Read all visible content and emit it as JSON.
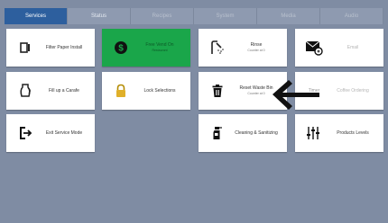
{
  "tabs": [
    "Services",
    "Status",
    "Recipes",
    "System",
    "Media",
    "Audio"
  ],
  "tiles": {
    "filter_paper": {
      "label": "Filter Paper Install"
    },
    "free_vend": {
      "label": "Free Vend On",
      "sub": "Restaurant"
    },
    "rinse": {
      "label": "Rinse",
      "sub": "Counter at 0"
    },
    "email": {
      "label": "Email"
    },
    "fill_carafe": {
      "label": "Fill up a Carafe"
    },
    "lock": {
      "label": "Lock Selections"
    },
    "reset_waste": {
      "label": "Reset Waste Bin",
      "sub": "Counter at 0"
    },
    "timer": {
      "label": "Timer"
    },
    "coffee_ordering": {
      "label": "Coffee Ordering"
    },
    "exit": {
      "label": "Exit Service Mode"
    },
    "cleaning": {
      "label": "Cleaning & Sanitizing"
    },
    "products": {
      "label": "Products Levels"
    }
  },
  "colors": {
    "accent": "#2d5f9e",
    "green": "#1aa64a",
    "background": "#7f8ca3"
  }
}
